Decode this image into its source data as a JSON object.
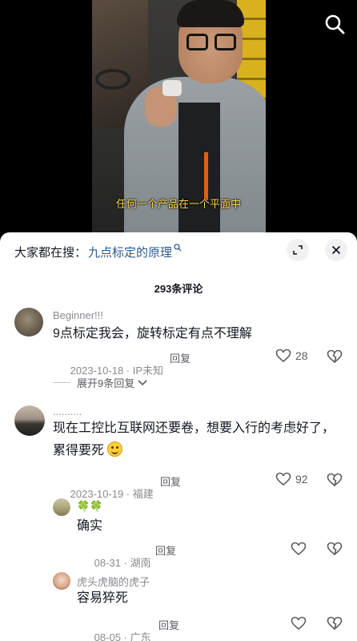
{
  "video": {
    "subtitle": "任何一个产品在一个平面中",
    "search_icon": "search-icon"
  },
  "sheet": {
    "search_prefix": "大家都在搜：",
    "search_term": "九点标定的原理",
    "search_term_icon": "search-icon",
    "expand_icon": "expand-icon",
    "close_icon": "close-icon",
    "comment_count": "293条评论"
  },
  "comments": [
    {
      "username": "Beginner!!!",
      "text": "9点标定我会，旋转标定有点不理解",
      "date": "2023-10-18",
      "location": "IP未知",
      "reply_label": "回复",
      "likes": "28",
      "expand_replies": "展开9条回复"
    },
    {
      "username": "..........",
      "text_line1": "现在工控比互联网还要卷，想要入行的考虑好了，",
      "text_line2": "累得要死",
      "date": "2023-10-19",
      "location": "福建",
      "reply_label": "回复",
      "likes": "92",
      "replies": [
        {
          "username": "🍀🍀",
          "text": "确实",
          "date": "08-31",
          "location": "湖南",
          "reply_label": "回复"
        },
        {
          "username": "虎头虎脑的虎子",
          "text": "容易猝死",
          "date": "08-05",
          "location": "广东",
          "reply_label": "回复"
        }
      ]
    }
  ],
  "colors": {
    "subtitle": "#ffd54a",
    "search_term": "#2b5b8f",
    "meta": "#8a8b91",
    "text": "#161823"
  }
}
